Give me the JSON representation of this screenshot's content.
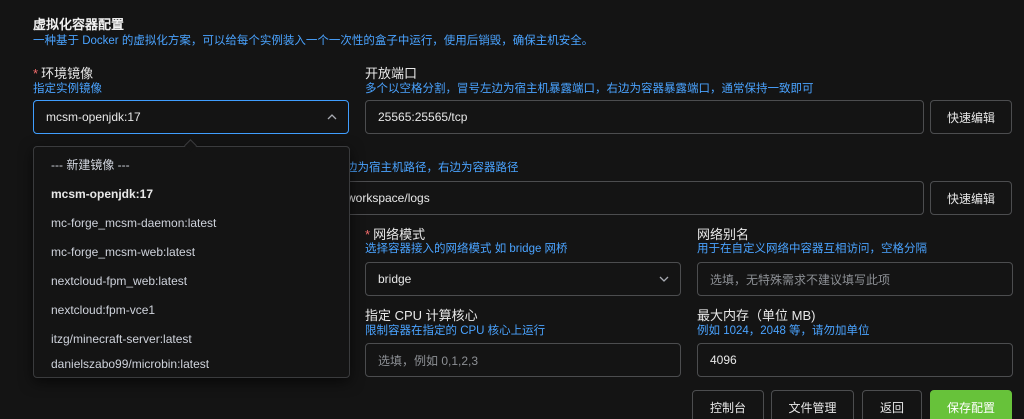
{
  "section": {
    "title": "虚拟化容器配置",
    "description": "一种基于 Docker 的虚拟化方案，可以给每个实例装入一个一次性的盒子中运行，使用后销毁，确保主机安全。"
  },
  "image": {
    "label": "环境镜像",
    "sublabel": "指定实例镜像",
    "value": "mcsm-openjdk:17",
    "options": [
      "--- 新建镜像 ---",
      "mcsm-openjdk:17",
      "mc-forge_mcsm-daemon:latest",
      "mc-forge_mcsm-web:latest",
      "nextcloud-fpm_web:latest",
      "nextcloud:fpm-vce1",
      "itzg/minecraft-server:latest",
      "danielszabo99/microbin:latest"
    ],
    "selected_option": "mcsm-openjdk:17"
  },
  "ports": {
    "label": "开放端口",
    "sublabel": "多个以空格分割，冒号左边为宿主机暴露端口，右边为容器暴露端口，通常保持一致即可",
    "value": "25565:25565/tcp",
    "quick_edit": "快速编辑"
  },
  "volumes": {
    "sublabel_visible": "边为宿主机路径，右边为容器路径",
    "value_visible": "workspace/logs",
    "quick_edit": "快速编辑"
  },
  "network_mode": {
    "label": "网络模式",
    "sublabel": "选择容器接入的网络模式 如 bridge 网桥",
    "value": "bridge"
  },
  "network_alias": {
    "label": "网络别名",
    "sublabel": "用于在自定义网络中容器互相访问，空格分隔",
    "placeholder": "选填，无特殊需求不建议填写此项"
  },
  "cpu": {
    "label": "指定 CPU 计算核心",
    "sublabel": "限制容器在指定的 CPU 核心上运行",
    "placeholder": "选填，例如 0,1,2,3"
  },
  "memory": {
    "label": "最大内存（单位 MB)",
    "sublabel": "例如 1024，2048 等，请勿加单位",
    "value": "4096"
  },
  "actions": {
    "console": "控制台",
    "file_manager": "文件管理",
    "back": "返回",
    "save": "保存配置"
  },
  "colors": {
    "accent": "#409eff",
    "sublabel": "#4aa3ff",
    "required": "#f56c6c",
    "save": "#67c23a"
  }
}
